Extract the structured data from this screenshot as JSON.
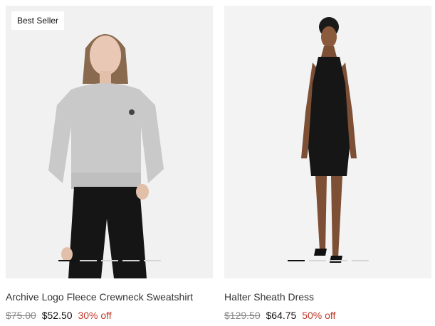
{
  "products": [
    {
      "badge": "Best Seller",
      "name": "Archive Logo Fleece Crewneck Sweatshirt",
      "original_price": "$75.00",
      "sale_price": "$52.50",
      "discount": "30% off",
      "image_icon": "sweatshirt-model-photo",
      "active_slide": 0,
      "slide_count": 5
    },
    {
      "name": "Halter Sheath Dress",
      "original_price": "$129.50",
      "sale_price": "$64.75",
      "discount": "50% off",
      "image_icon": "dress-model-photo",
      "active_slide": 0,
      "slide_count": 4
    }
  ],
  "colors": {
    "discount": "#c0392b",
    "image_bg": "#f2f2f2",
    "active_dot": "#111111",
    "inactive_dot": "#d6d6d6"
  }
}
